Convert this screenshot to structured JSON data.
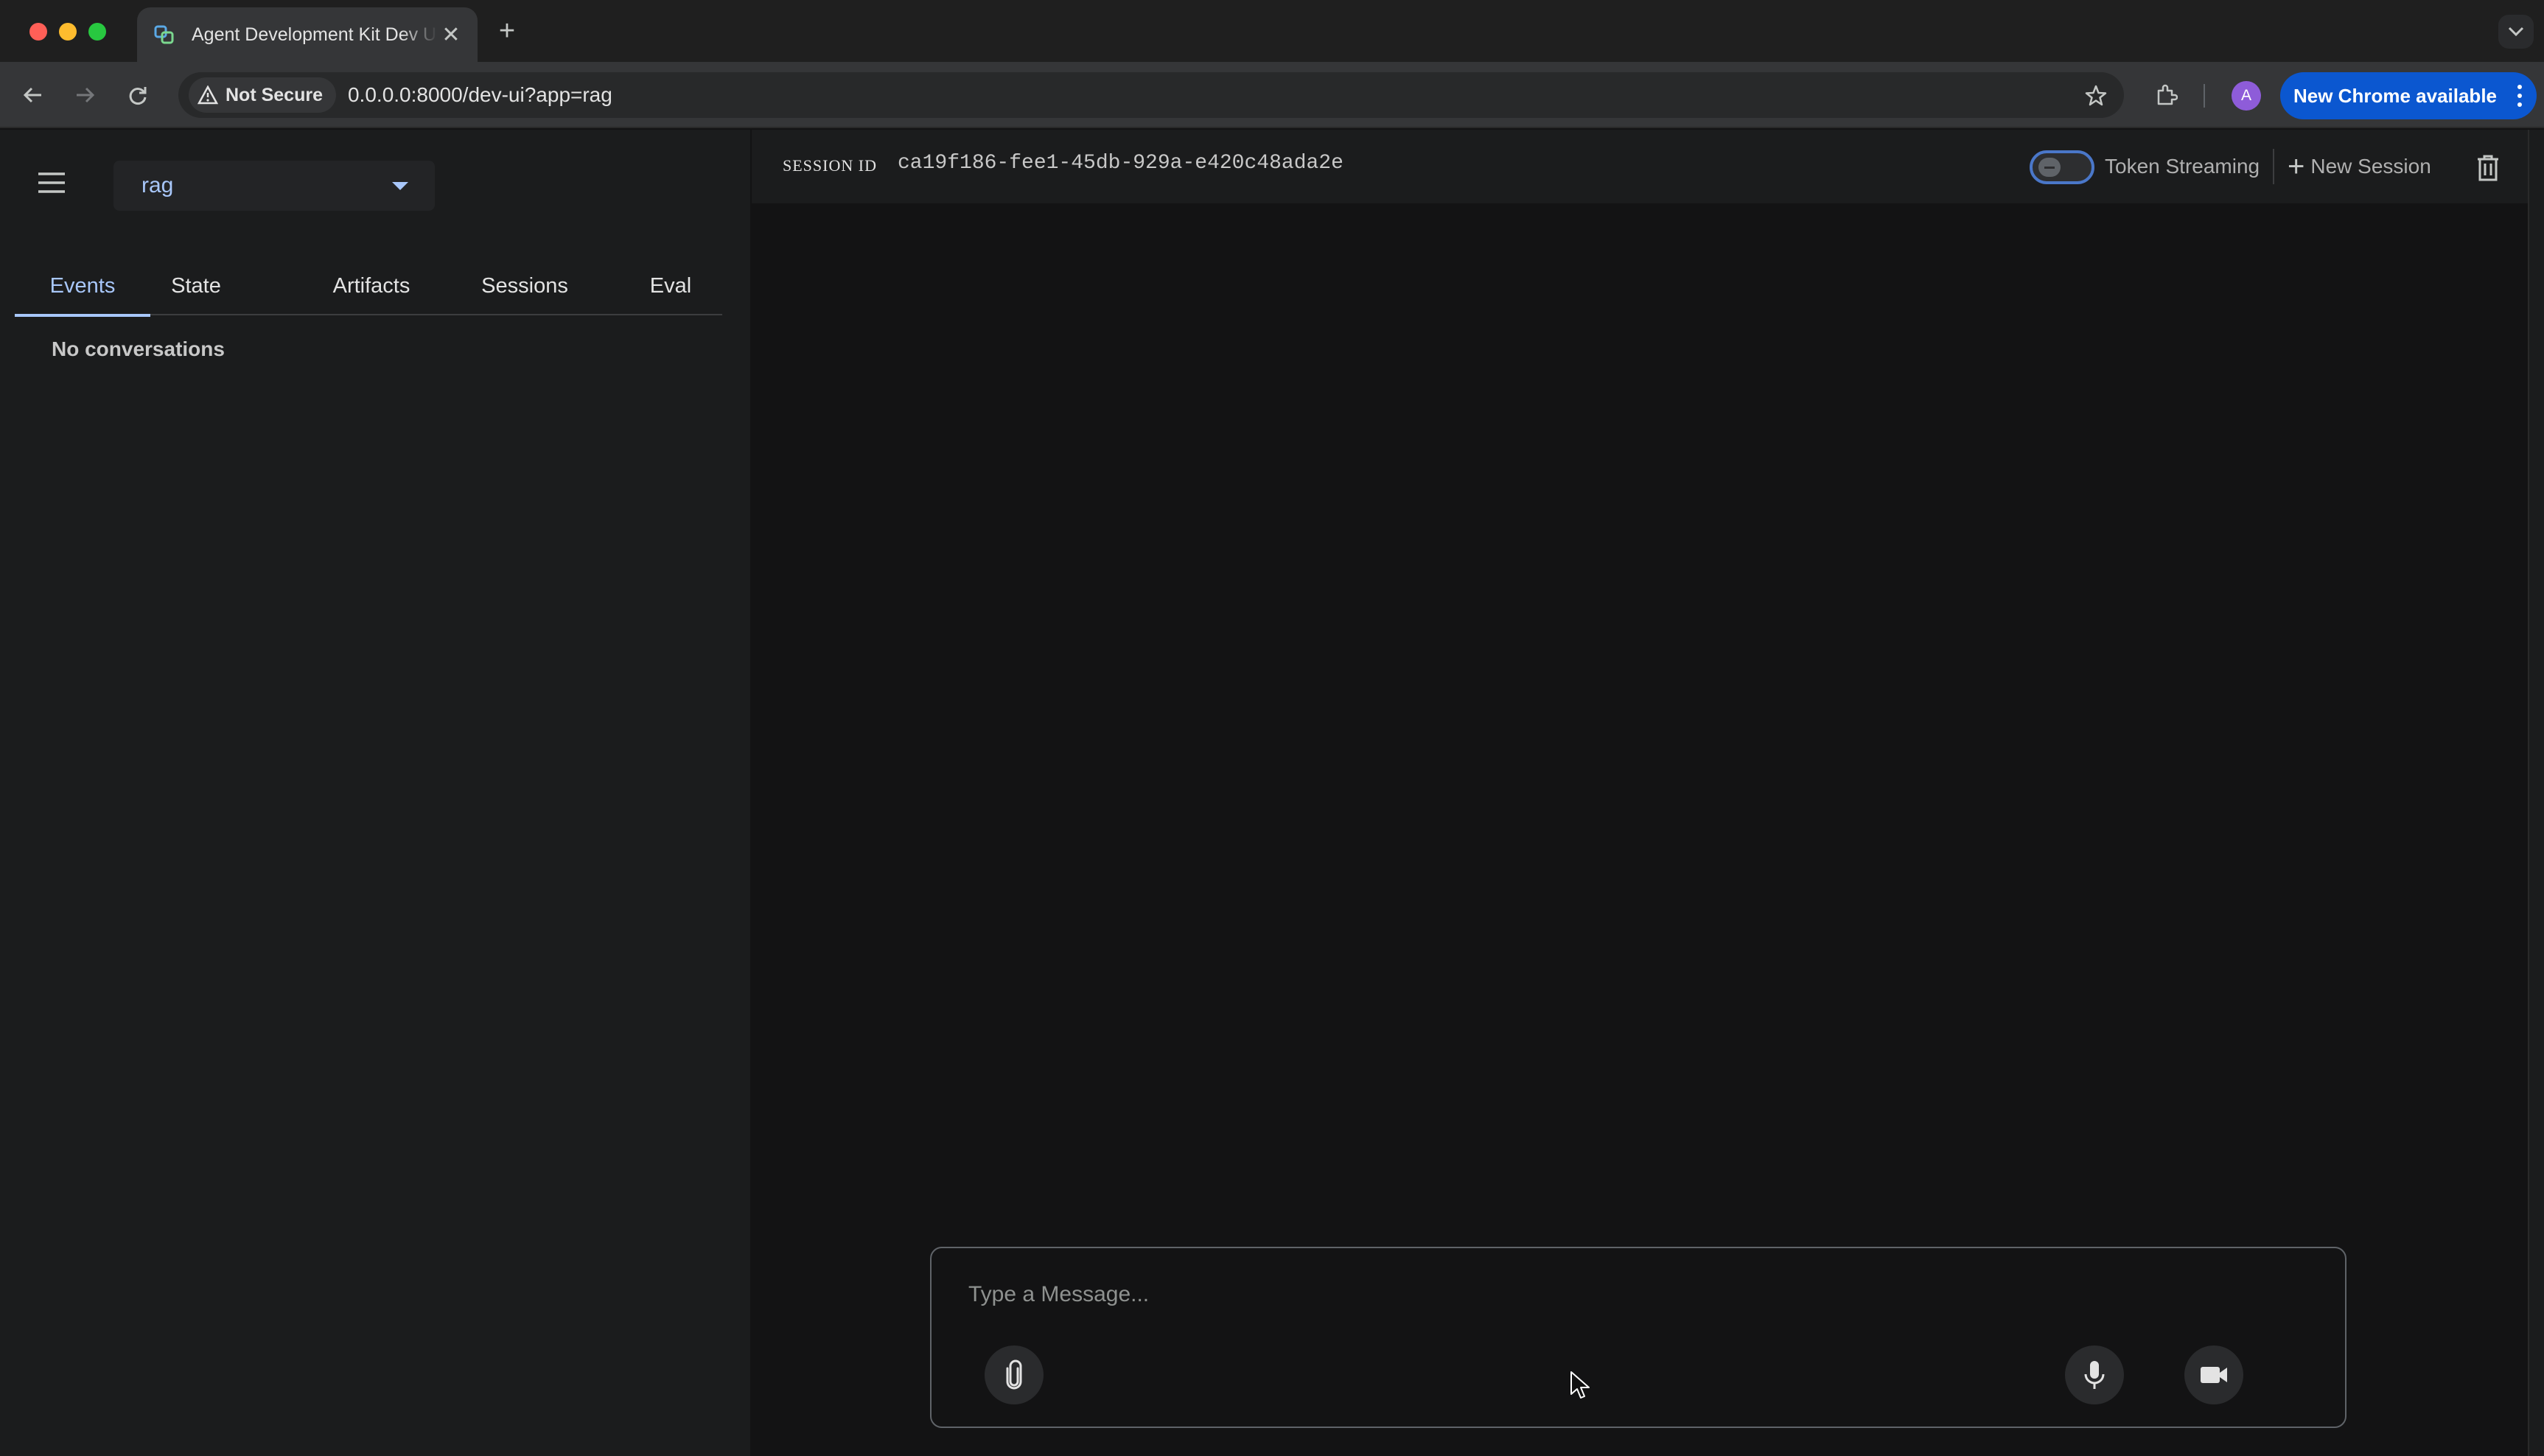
{
  "browser": {
    "tab_title": "Agent Development Kit Dev UI",
    "security_label": "Not Secure",
    "url": "0.0.0.0:8000/dev-ui?app=rag",
    "profile_initial": "A",
    "update_label": "New Chrome available"
  },
  "sidebar": {
    "selected_app": "rag",
    "tabs": [
      {
        "label": "Events",
        "active": true
      },
      {
        "label": "State",
        "active": false
      },
      {
        "label": "Artifacts",
        "active": false
      },
      {
        "label": "Sessions",
        "active": false
      },
      {
        "label": "Eval",
        "active": false
      }
    ],
    "empty_message": "No conversations"
  },
  "main": {
    "session_label": "SESSION ID",
    "session_id": "ca19f186-fee1-45db-929a-e420c48ada2e",
    "token_streaming_label": "Token Streaming",
    "token_streaming_enabled": false,
    "new_session_label": "New Session"
  },
  "composer": {
    "placeholder": "Type a Message..."
  },
  "colors": {
    "accent": "#a8c7fa",
    "background": "#131314",
    "panel": "#1b1c1d",
    "chrome_update": "#0b57d0"
  },
  "icons": [
    "menu-icon",
    "dropdown-caret-icon",
    "attach-icon",
    "mic-icon",
    "video-camera-icon",
    "trash-icon",
    "plus-icon",
    "star-icon",
    "extensions-icon",
    "warning-icon"
  ]
}
